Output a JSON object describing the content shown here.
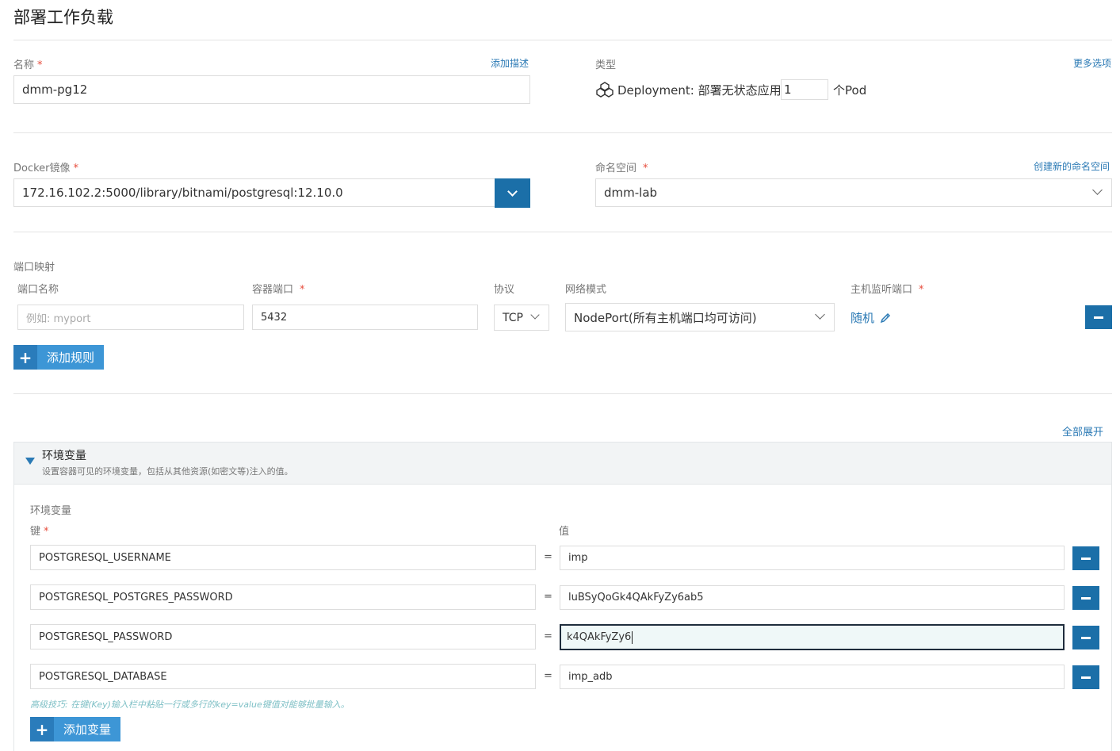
{
  "page": {
    "title": "部署工作负载"
  },
  "name_field": {
    "label": "名称",
    "required": "*",
    "value": "dmm-pg12",
    "add_desc_link": "添加描述"
  },
  "type_field": {
    "label": "类型",
    "more_options_link": "更多选项",
    "deployment_label": "Deployment:",
    "deployment_desc": "部署无状态应用",
    "replicas": "1",
    "unit": "个Pod"
  },
  "image_field": {
    "label": "Docker镜像",
    "required": "*",
    "value": "172.16.102.2:5000/library/bitnami/postgresql:12.10.0"
  },
  "namespace_field": {
    "label": "命名空间",
    "required": "*",
    "create_link": "创建新的命名空间",
    "value": "dmm-lab"
  },
  "ports": {
    "section_label": "端口映射",
    "headers": {
      "name": "端口名称",
      "container_port": "容器端口",
      "protocol": "协议",
      "network_mode": "网络模式",
      "host_port": "主机监听端口"
    },
    "required": "*",
    "row": {
      "name_placeholder": "例如: myport",
      "container_port": "5432",
      "protocol": "TCP",
      "network_mode": "NodePort(所有主机端口均可访问)",
      "host_port": "随机"
    },
    "add_rule_label": "添加规则"
  },
  "env": {
    "expand_all_link": "全部展开",
    "panel_title": "环境变量",
    "panel_subtitle": "设置容器可见的环境变量，包括从其他资源(如密文等)注入的值。",
    "section_label": "环境变量",
    "key_label": "键",
    "value_label": "值",
    "required": "*",
    "eq": "=",
    "rows": [
      {
        "key": "POSTGRESQL_USERNAME",
        "value": "imp"
      },
      {
        "key": "POSTGRESQL_POSTGRES_PASSWORD",
        "value": "luBSyQoGk4QAkFyZy6ab5"
      },
      {
        "key": "POSTGRESQL_PASSWORD",
        "value": "k4QAkFyZy6"
      },
      {
        "key": "POSTGRESQL_DATABASE",
        "value": "imp_adb"
      }
    ],
    "hint": "高级技巧: 在键(Key)输入栏中粘贴一行或多行的key=value键值对能够批量输入。",
    "add_var_label": "添加变量"
  },
  "colors": {
    "primary": "#1b6fa8",
    "add_button": "#3d96d6",
    "link": "#2b7ab5",
    "required": "#e74c3c"
  }
}
